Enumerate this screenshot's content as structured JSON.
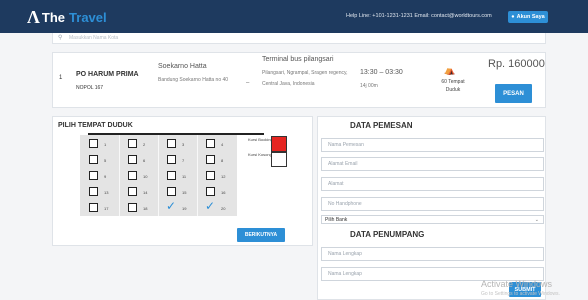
{
  "header": {
    "brand_prefix": "The",
    "brand_name": "Travel",
    "contact_line": "Help Line: +101-1231-1231  Email: contact@worldtours.com",
    "account_label": "Akun Saya",
    "account_icon": "user-icon"
  },
  "search": {
    "icon": "search-icon",
    "placeholder": "Masukkan Nama Kota"
  },
  "trip": {
    "index": "1",
    "bus_name": "PO HARUM PRIMA",
    "plate": "NOPOL 167",
    "origin_name": "Soekarno Hatta",
    "origin_address": "Bandung Soekarno Hatta no 40",
    "separator": "–",
    "destination_name": "Terminal bus pilangsari",
    "destination_address": "Pilangsari, Ngrampal, Sragen regency, Central Java, Indonesia",
    "time_range": "13:30 – 03:30",
    "duration": "14j 00m",
    "seat_icon": "seat-icon",
    "seats_info": "60 Tempat Duduk",
    "price": "Rp. 160000",
    "book_label": "PESAN"
  },
  "seat_selector": {
    "title": "PILIH TEMPAT DUDUK",
    "rows": [
      [
        {
          "n": "1",
          "s": false
        },
        {
          "n": "2",
          "s": false
        },
        {
          "n": "3",
          "s": false
        },
        {
          "n": "4",
          "s": false
        }
      ],
      [
        {
          "n": "5",
          "s": false
        },
        {
          "n": "6",
          "s": false
        },
        {
          "n": "7",
          "s": false
        },
        {
          "n": "8",
          "s": false
        }
      ],
      [
        {
          "n": "9",
          "s": false
        },
        {
          "n": "10",
          "s": false
        },
        {
          "n": "11",
          "s": false
        },
        {
          "n": "12",
          "s": false
        }
      ],
      [
        {
          "n": "13",
          "s": false
        },
        {
          "n": "14",
          "s": false
        },
        {
          "n": "15",
          "s": false
        },
        {
          "n": "16",
          "s": false
        }
      ],
      [
        {
          "n": "17",
          "s": false
        },
        {
          "n": "18",
          "s": false
        },
        {
          "n": "19",
          "s": true
        },
        {
          "n": "20",
          "s": true
        }
      ]
    ],
    "legend_booked": "Kursi Booking",
    "legend_empty": "Kursi Kosong",
    "legend_booked_color": "#e52521",
    "check_color": "#2d8fd6",
    "next_label": "BERIKUTNYA"
  },
  "booking_form": {
    "orderer_title": "DATA PEMESAN",
    "name_placeholder": "Nama Pemesan",
    "email_placeholder": "Alamat Email",
    "address_placeholder": "Alamat",
    "phone_placeholder": "No Handphone",
    "bank_selected": "Pilih Bank",
    "passenger_title": "DATA PENUMPANG",
    "passenger_1_placeholder": "Nama Lengkap",
    "passenger_2_placeholder": "Nama Lengkap",
    "submit_label": "SUBMIT"
  },
  "watermark": {
    "line1": "Activate Windows",
    "line2": "Go to Settings to activate Windows."
  },
  "colors": {
    "header_bg": "#1e3a5f",
    "accent": "#2d8fd6"
  }
}
